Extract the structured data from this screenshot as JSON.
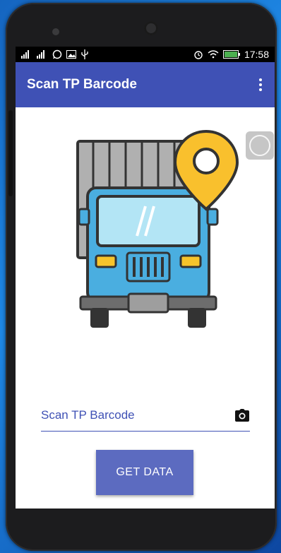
{
  "status_bar": {
    "signal_icons": [
      "signal-1-icon",
      "signal-2-icon",
      "whatsapp-icon",
      "gallery-icon",
      "usb-icon"
    ],
    "right_icons": [
      "alarm-icon",
      "wifi-icon",
      "battery-icon"
    ],
    "time": "17:58"
  },
  "app_bar": {
    "title": "Scan TP Barcode",
    "menu_icon": "more-vert-icon"
  },
  "illustration": {
    "name": "truck-with-location-pin",
    "colors": {
      "truck_body": "#4aaee0",
      "cargo": "#b0b0b0",
      "pin": "#f9c02d",
      "lights": "#f7c42b",
      "windshield": "#b3e5f5"
    }
  },
  "form": {
    "input_placeholder": "Scan TP Barcode",
    "input_value": "",
    "camera_icon": "camera-icon"
  },
  "actions": {
    "get_data_label": "GET DATA"
  },
  "theme": {
    "primary": "#3f51b5",
    "button": "#5c6bc0"
  }
}
